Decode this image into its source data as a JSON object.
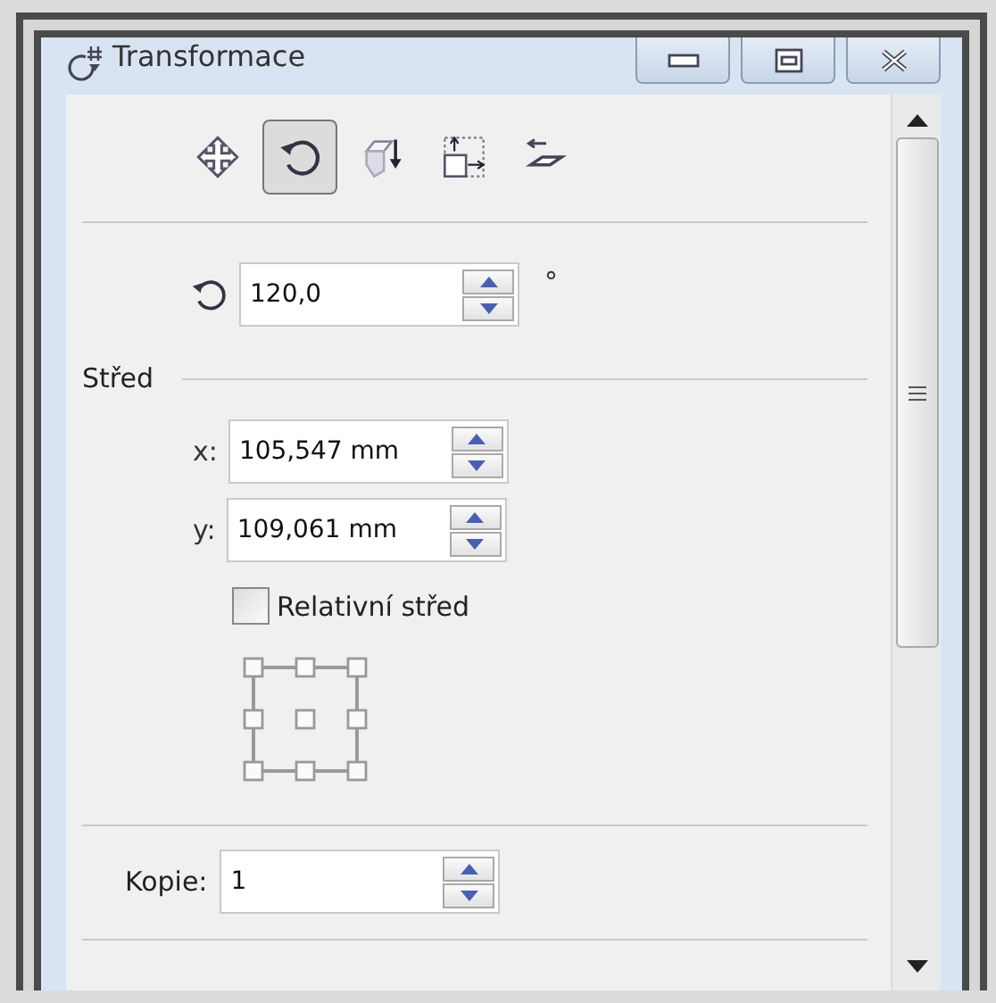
{
  "window": {
    "title": "Transformace"
  },
  "tools": [
    {
      "kind": "position",
      "selected": false
    },
    {
      "kind": "rotate",
      "selected": true
    },
    {
      "kind": "scale",
      "selected": false
    },
    {
      "kind": "size",
      "selected": false
    },
    {
      "kind": "skew",
      "selected": false
    }
  ],
  "rotation": {
    "value": "120,0",
    "unit": "°"
  },
  "center": {
    "heading": "Střed",
    "fields": [
      {
        "label": "x:",
        "value": "105,547 mm"
      },
      {
        "label": "y:",
        "value": "109,061 mm"
      }
    ],
    "relative": {
      "label": "Relativní střed",
      "checked": false
    }
  },
  "copies": {
    "label": "Kopie:",
    "value": "1"
  }
}
